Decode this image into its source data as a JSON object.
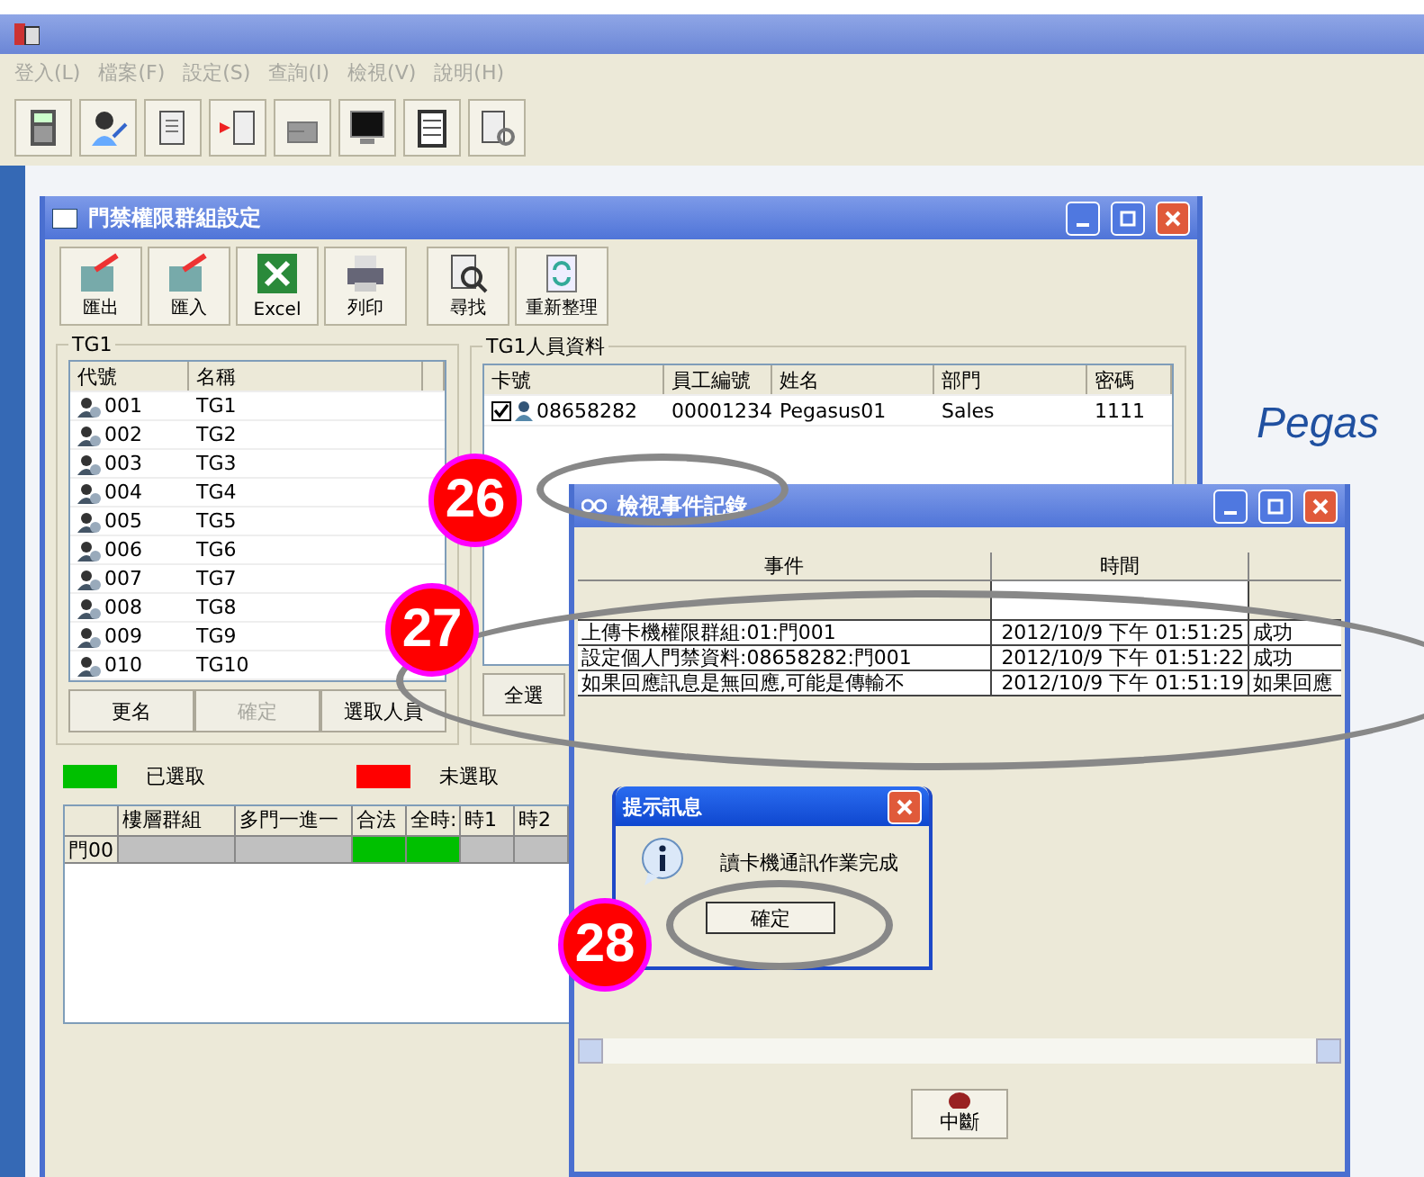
{
  "menu": [
    {
      "label": "登入(L)",
      "disabled": true
    },
    {
      "label": "檔案(F)",
      "disabled": true
    },
    {
      "label": "設定(S)",
      "disabled": true
    },
    {
      "label": "查詢(I)",
      "disabled": true
    },
    {
      "label": "檢視(V)",
      "disabled": true
    },
    {
      "label": "說明(H)",
      "disabled": true
    }
  ],
  "logo": {
    "text": "Pegas"
  },
  "group_window": {
    "title": "門禁權限群組設定",
    "toolbar": [
      {
        "label": "匯出",
        "kind": "export"
      },
      {
        "label": "匯入",
        "kind": "import"
      },
      {
        "label": "Excel",
        "kind": "excel"
      },
      {
        "label": "列印",
        "kind": "print"
      },
      {
        "label": "尋找",
        "kind": "find"
      },
      {
        "label": "重新整理",
        "kind": "refresh"
      }
    ],
    "group_list": {
      "title": "TG1",
      "columns": [
        "代號",
        "名稱"
      ],
      "rows": [
        {
          "code": "001",
          "name": "TG1"
        },
        {
          "code": "002",
          "name": "TG2"
        },
        {
          "code": "003",
          "name": "TG3"
        },
        {
          "code": "004",
          "name": "TG4"
        },
        {
          "code": "005",
          "name": "TG5"
        },
        {
          "code": "006",
          "name": "TG6"
        },
        {
          "code": "007",
          "name": "TG7"
        },
        {
          "code": "008",
          "name": "TG8"
        },
        {
          "code": "009",
          "name": "TG9"
        },
        {
          "code": "010",
          "name": "TG10"
        }
      ]
    },
    "buttons": [
      {
        "label": "更名",
        "disabled": false
      },
      {
        "label": "確定",
        "disabled": true
      },
      {
        "label": "選取人員",
        "disabled": false
      }
    ],
    "person_panel": {
      "title": "TG1人員資料",
      "columns": [
        "卡號",
        "員工編號",
        "姓名",
        "部門",
        "密碼"
      ],
      "rows": [
        {
          "checked": true,
          "cells": [
            "08658282",
            "00001234",
            "Pegasus01",
            "Sales",
            "1111"
          ]
        }
      ],
      "button": "全選"
    },
    "legend": [
      {
        "label": "已選取",
        "color": "#00c000"
      },
      {
        "label": "未選取",
        "color": "#ff0000"
      }
    ],
    "grid": {
      "columns": [
        "樓層群組",
        "多門一進一",
        "合法",
        "全時:",
        "時1",
        "時2"
      ],
      "rows": [
        {
          "label": "門00",
          "cells": [
            {
              "color": "#c0c0c0"
            },
            {
              "color": "#c0c0c0"
            },
            {
              "color": "#00c000"
            },
            {
              "color": "#00c000"
            },
            {
              "color": "#c0c0c0"
            },
            {
              "color": "#c0c0c0"
            }
          ]
        }
      ]
    }
  },
  "event_window": {
    "title": "檢視事件記錄",
    "columns": [
      "事件",
      "時間"
    ],
    "rows": [
      {
        "event": "上傳卡機權限群組:01:門001",
        "time": "2012/10/9 下午 01:51:25",
        "result": "成功"
      },
      {
        "event": "設定個人門禁資料:08658282:門001",
        "time": "2012/10/9 下午 01:51:22",
        "result": "成功"
      },
      {
        "event": "如果回應訊息是無回應,可能是傳輸不",
        "time": "2012/10/9 下午 01:51:19",
        "result": "如果回應"
      }
    ],
    "stop_button": "中斷"
  },
  "message_box": {
    "title": "提示訊息",
    "text": "讀卡機通訊作業完成",
    "button": "確定"
  },
  "callouts": [
    {
      "number": "26"
    },
    {
      "number": "27"
    },
    {
      "number": "28"
    }
  ]
}
